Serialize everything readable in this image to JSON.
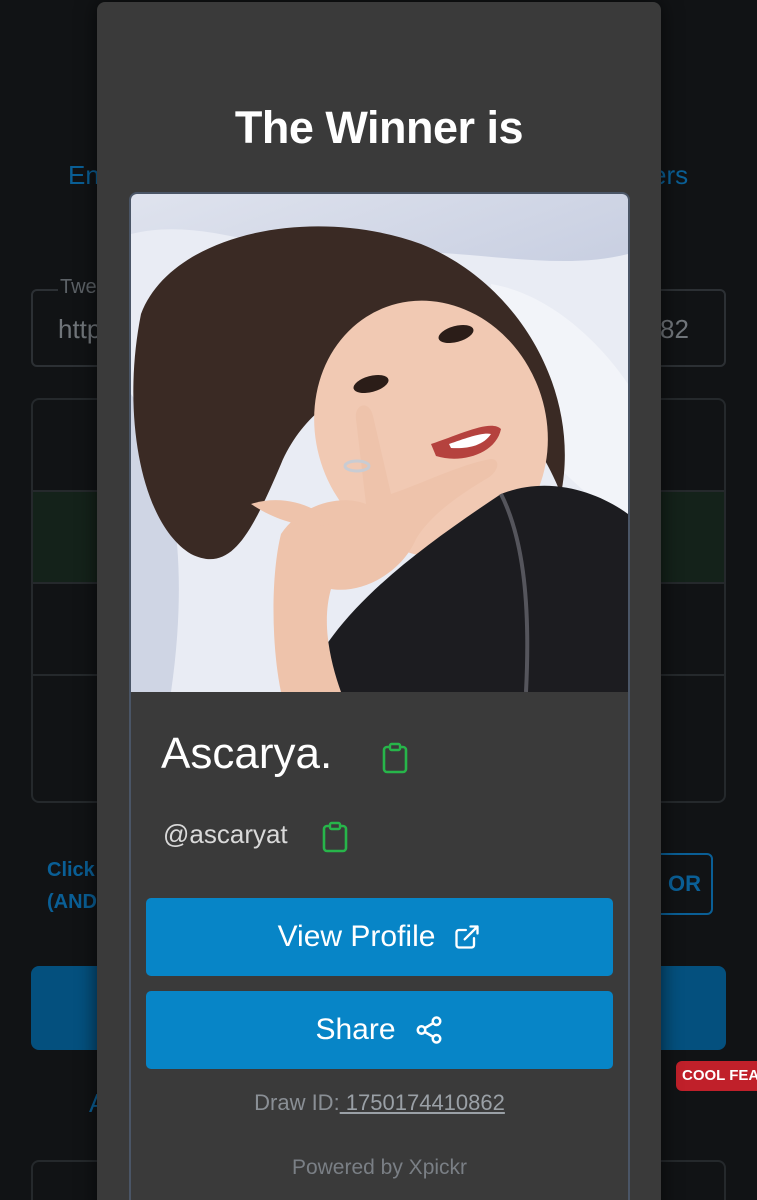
{
  "background": {
    "tab_left": "En",
    "tab_right": "ers",
    "field_label": "Twe",
    "field_value_left": "http",
    "field_value_right": "82",
    "click_text_line1": "Click",
    "click_text_line2": "(AND",
    "or_button": "OR",
    "cool_badge": "COOL FEA",
    "link_left": "A",
    "link_right": ")"
  },
  "modal": {
    "title": "The Winner is",
    "winner": {
      "display_name": "Ascarya.",
      "handle": "@ascaryat"
    },
    "buttons": {
      "view_profile": "View Profile",
      "share": "Share"
    },
    "draw_id_label": "Draw ID:",
    "draw_id_value": " 1750174410862",
    "powered_by": "Powered by Xpickr"
  },
  "colors": {
    "accent": "#0785c7",
    "copy_icon": "#27b54a",
    "modal_bg": "#3a3a3a",
    "page_bg": "#111315"
  },
  "icons": {
    "copy": "clipboard-icon",
    "external": "external-link-icon",
    "share": "share-nodes-icon"
  }
}
